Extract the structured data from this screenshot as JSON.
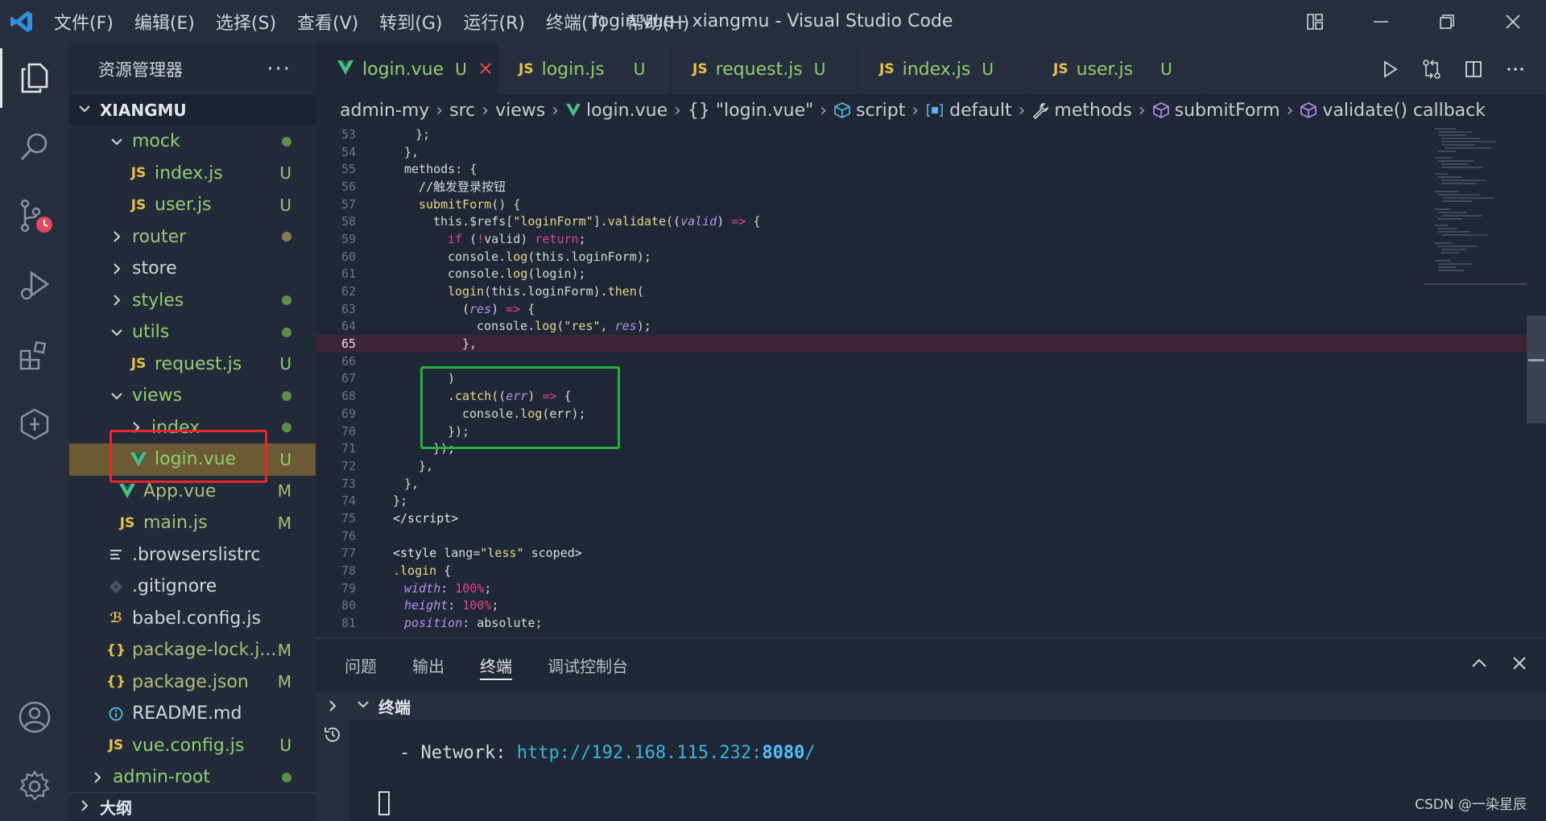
{
  "title_bar": {
    "menu": [
      "文件(F)",
      "编辑(E)",
      "选择(S)",
      "查看(V)",
      "转到(G)",
      "运行(R)",
      "终端(T)",
      "帮助(H)"
    ],
    "window_title": "login.vue - xiangmu - Visual Studio Code"
  },
  "sidebar": {
    "title": "资源管理器",
    "more": "···",
    "root": "XIANGMU",
    "items": [
      {
        "label": "mock",
        "status": ""
      },
      {
        "label": "index.js",
        "status": "U"
      },
      {
        "label": "user.js",
        "status": "U"
      },
      {
        "label": "router",
        "status": ""
      },
      {
        "label": "store",
        "status": ""
      },
      {
        "label": "styles",
        "status": ""
      },
      {
        "label": "utils",
        "status": ""
      },
      {
        "label": "request.js",
        "status": "U"
      },
      {
        "label": "views",
        "status": ""
      },
      {
        "label": "index",
        "status": ""
      },
      {
        "label": "login.vue",
        "status": "U"
      },
      {
        "label": "App.vue",
        "status": "M"
      },
      {
        "label": "main.js",
        "status": "M"
      },
      {
        "label": ".browserslistrc",
        "status": ""
      },
      {
        "label": ".gitignore",
        "status": ""
      },
      {
        "label": "babel.config.js",
        "status": ""
      },
      {
        "label": "package-lock.j...",
        "status": "M"
      },
      {
        "label": "package.json",
        "status": "M"
      },
      {
        "label": "README.md",
        "status": ""
      },
      {
        "label": "vue.config.js",
        "status": "U"
      },
      {
        "label": "admin-root",
        "status": ""
      }
    ],
    "outline": "大纲"
  },
  "tabs": [
    {
      "label": "login.vue",
      "status": "U",
      "icon": "V"
    },
    {
      "label": "login.js",
      "status": "U",
      "icon": "JS"
    },
    {
      "label": "request.js",
      "status": "U",
      "icon": "JS"
    },
    {
      "label": "index.js",
      "status": "U",
      "icon": "JS"
    },
    {
      "label": "user.js",
      "status": "U",
      "icon": "JS"
    }
  ],
  "breadcrumb": [
    "admin-my",
    "src",
    "views",
    "login.vue",
    "{} \"login.vue\"",
    "script",
    "default",
    "methods",
    "submitForm",
    "validate() callback"
  ],
  "code": {
    "line_numbers": [
      "53",
      "54",
      "55",
      "56",
      "57",
      "58",
      "59",
      "60",
      "61",
      "62",
      "63",
      "64",
      "65",
      "66",
      "67",
      "68",
      "69",
      "70",
      "71",
      "72",
      "73",
      "74",
      "75",
      "76",
      "77",
      "78",
      "79",
      "80",
      "81"
    ],
    "current_line": "65"
  },
  "panel": {
    "tabs": [
      "问题",
      "输出",
      "终端",
      "调试控制台"
    ],
    "terminal_header": "终端",
    "network_label": "- Network: ",
    "network_url": "http://192.168.115.232:",
    "network_port": "8080",
    "network_tail": "/"
  },
  "watermark": "CSDN @一染星辰",
  "colors": {
    "accent_untracked": "#8ed06e",
    "accent_modified": "#b0bb7a",
    "annotation_red": "#e8262a",
    "annotation_green": "#22b33a"
  }
}
